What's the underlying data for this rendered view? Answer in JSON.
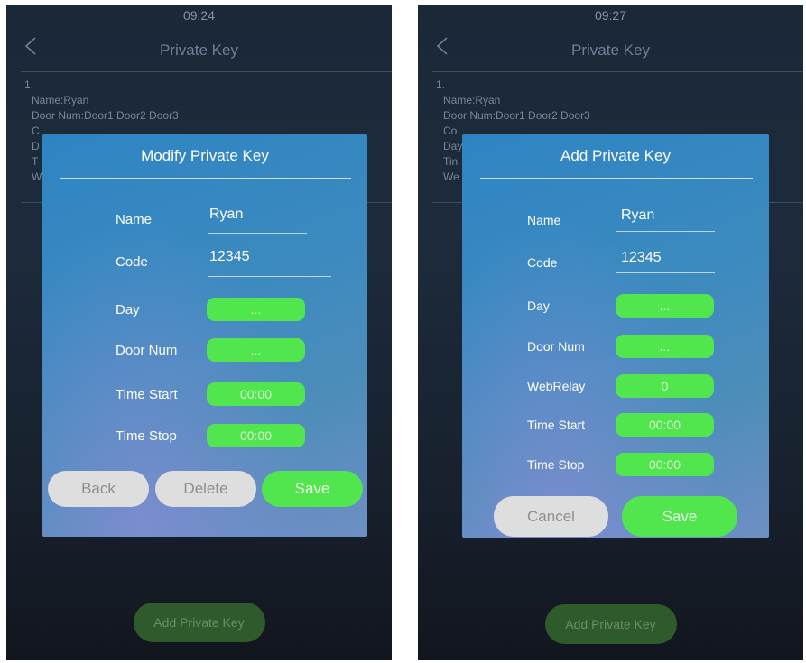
{
  "left": {
    "status_time": "09:24",
    "title": "Private Key",
    "record": {
      "index": "1.",
      "lines": [
        "Name:Ryan",
        "Door Num:Door1 Door2 Door3",
        "C",
        "D",
        "T",
        "W"
      ]
    },
    "dialog": {
      "title": "Modify Private Key",
      "name_label": "Name",
      "name_value": "Ryan",
      "code_label": "Code",
      "code_value": "12345",
      "day_label": "Day",
      "day_value": "...",
      "door_label": "Door Num",
      "door_value": "...",
      "time_start_label": "Time Start",
      "time_start_value": "00:00",
      "time_stop_label": "Time Stop",
      "time_stop_value": "00:00",
      "back_label": "Back",
      "delete_label": "Delete",
      "save_label": "Save"
    },
    "add_button": "Add Private Key"
  },
  "right": {
    "status_time": "09:27",
    "title": "Private Key",
    "record": {
      "index": "1.",
      "lines": [
        "Name:Ryan",
        "Door Num:Door1 Door2 Door3",
        "Co",
        "Day",
        "Tin",
        "We"
      ]
    },
    "dialog": {
      "title": "Add Private Key",
      "name_label": "Name",
      "name_value": "Ryan",
      "code_label": "Code",
      "code_value": "12345",
      "day_label": "Day",
      "day_value": "...",
      "door_label": "Door Num",
      "door_value": "...",
      "webrelay_label": "WebRelay",
      "webrelay_value": "0",
      "time_start_label": "Time Start",
      "time_start_value": "00:00",
      "time_stop_label": "Time Stop",
      "time_stop_value": "00:00",
      "cancel_label": "Cancel",
      "save_label": "Save"
    },
    "add_button": "Add Private Key"
  }
}
